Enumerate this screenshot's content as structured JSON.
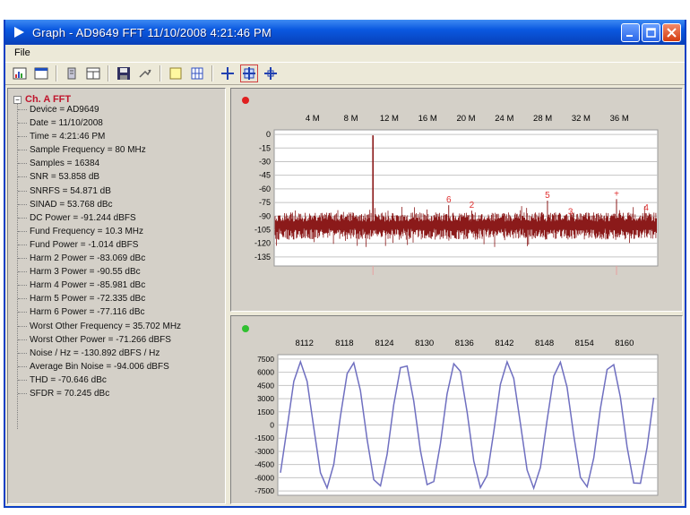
{
  "window": {
    "title": "Graph - AD9649 FFT 11/10/2008 4:21:46 PM"
  },
  "menu": {
    "items": [
      {
        "label": "File"
      }
    ]
  },
  "toolbar": {
    "buttons": [
      "chart-icon",
      "window-icon",
      "marker-icon",
      "table-icon",
      "save-icon",
      "export-icon",
      "note-icon",
      "grid-icon",
      "zoom-icon",
      "zoom-box-icon",
      "pan-icon"
    ]
  },
  "tree": {
    "root_label": "Ch. A FFT",
    "items": [
      "Device = AD9649",
      "Date = 11/10/2008",
      "Time = 4:21:46 PM",
      "Sample Frequency = 80 MHz",
      "Samples = 16384",
      "SNR = 53.858 dB",
      "SNRFS = 54.871 dB",
      "SINAD = 53.768 dBc",
      "DC Power = -91.244 dBFS",
      "Fund Frequency = 10.3 MHz",
      "Fund Power = -1.014 dBFS",
      "Harm 2 Power = -83.069 dBc",
      "Harm 3 Power = -90.55 dBc",
      "Harm 4 Power = -85.981 dBc",
      "Harm 5 Power = -72.335 dBc",
      "Harm 6 Power = -77.116 dBc",
      "Worst Other Frequency = 35.702 MHz",
      "Worst Other Power = -71.266 dBFS",
      "Noise / Hz = -130.892 dBFS / Hz",
      "Average Bin Noise = -94.006 dBFS",
      "THD = -70.646 dBc",
      "SFDR = 70.245 dBc"
    ]
  },
  "colors": {
    "fft_trace": "#8b1a1a",
    "harmonic_marker": "#e03030",
    "time_trace": "#6f6fc0",
    "status_red": "#e02020",
    "status_green": "#30c030"
  },
  "chart_data": [
    {
      "type": "line",
      "name": "fft",
      "status": "red",
      "x_unit": "MHz",
      "x_range": [
        0,
        40
      ],
      "x_ticks": [
        4,
        8,
        12,
        16,
        20,
        24,
        28,
        32,
        36
      ],
      "x_tick_labels": [
        "4 M",
        "8 M",
        "12 M",
        "16 M",
        "20 M",
        "24 M",
        "28 M",
        "32 M",
        "36 M"
      ],
      "ylim": [
        -145,
        5
      ],
      "y_ticks": [
        0,
        -15,
        -30,
        -45,
        -60,
        -75,
        -90,
        -105,
        -120,
        -135
      ],
      "y_tick_labels": [
        "0",
        "-15",
        "-30",
        "-45",
        "-60",
        "-75",
        "-90",
        "-105",
        "-120",
        "-135"
      ],
      "noise_floor": -100,
      "fundamental": {
        "freq": 10.3,
        "power": -1.014
      },
      "harmonics": [
        {
          "label": "6",
          "freq": 18.2,
          "power": -78
        },
        {
          "label": "2",
          "freq": 20.6,
          "power": -84
        },
        {
          "label": "5",
          "freq": 28.5,
          "power": -73
        },
        {
          "label": "3",
          "freq": 30.9,
          "power": -91
        },
        {
          "label": "+",
          "freq": 35.7,
          "power": -71.3
        },
        {
          "label": "4",
          "freq": 38.8,
          "power": -87
        }
      ]
    },
    {
      "type": "line",
      "name": "time",
      "status": "green",
      "x_range": [
        8108,
        8165
      ],
      "x_ticks": [
        8112,
        8118,
        8124,
        8130,
        8136,
        8142,
        8148,
        8154,
        8160
      ],
      "x_tick_labels": [
        "8112",
        "8118",
        "8124",
        "8130",
        "8136",
        "8142",
        "8148",
        "8154",
        "8160"
      ],
      "ylim": [
        -8000,
        8000
      ],
      "y_ticks": [
        7500,
        6000,
        4500,
        3000,
        1500,
        0,
        -1500,
        -3000,
        -4500,
        -6000,
        -7500
      ],
      "y_tick_labels": [
        "7500",
        "6000",
        "4500",
        "3000",
        "1500",
        "0",
        "-1500",
        "-3000",
        "-4500",
        "-6000",
        "-7500"
      ],
      "amplitude": 7200,
      "period_samples": 7.77,
      "phase_sample": 8111.4
    }
  ]
}
